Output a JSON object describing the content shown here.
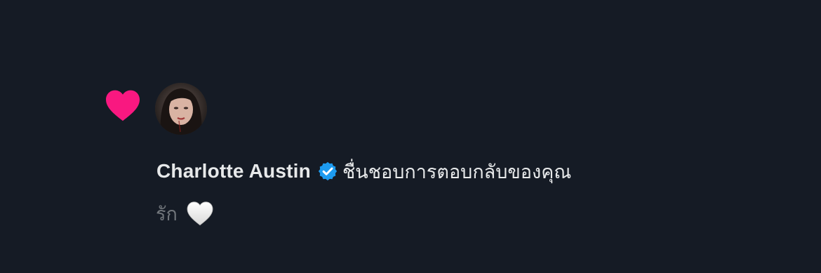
{
  "notification": {
    "type_icon": "heart-icon",
    "accent_color": "#f91880",
    "avatar_icon": "user-avatar",
    "user": {
      "name": "Charlotte Austin",
      "verified": true,
      "verified_icon": "verified-badge-icon",
      "verified_color": "#1d9bf0"
    },
    "action_text": "ชื่นชอบการตอบกลับของคุณ",
    "reply": {
      "text": "รัก",
      "emoji_icon": "white-heart-icon"
    }
  },
  "colors": {
    "background": "#151b25",
    "primary_text": "#e7e9ea",
    "secondary_text": "#71767b"
  }
}
